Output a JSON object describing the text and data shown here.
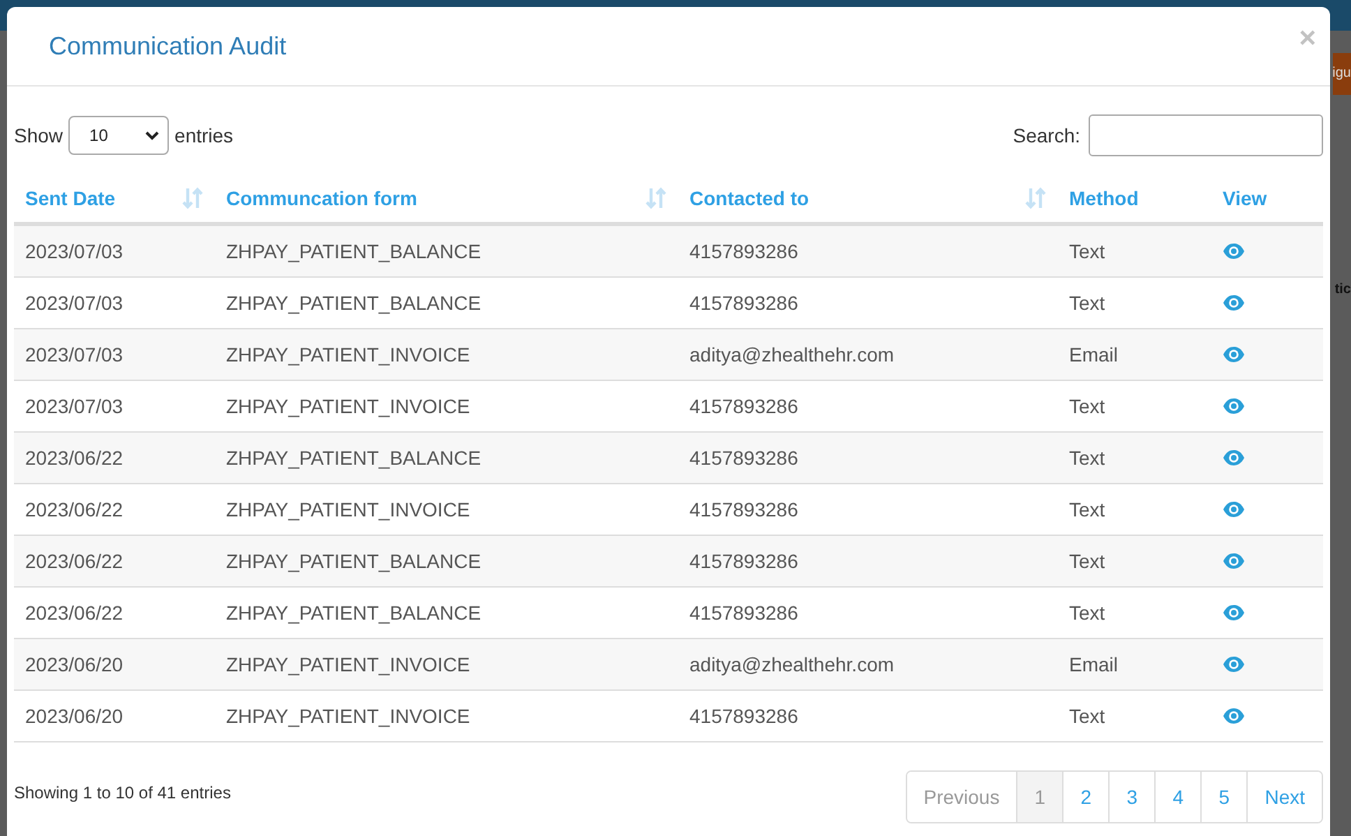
{
  "background": {
    "fragments": [
      {
        "text": "igu",
        "kind": "button"
      },
      {
        "text": "tic",
        "kind": "label"
      }
    ]
  },
  "modal": {
    "title": "Communication Audit",
    "close": "×"
  },
  "length_menu": {
    "before": "Show",
    "value": "10",
    "after": "entries"
  },
  "search": {
    "label": "Search:"
  },
  "table": {
    "columns": [
      {
        "label": "Sent Date",
        "sortable": true
      },
      {
        "label": "Communcation form",
        "sortable": true
      },
      {
        "label": "Contacted to",
        "sortable": true
      },
      {
        "label": "Method",
        "sortable": false
      },
      {
        "label": "View",
        "sortable": false
      }
    ],
    "rows": [
      [
        "2023/07/03",
        "ZHPAY_PATIENT_BALANCE",
        "4157893286",
        "Text"
      ],
      [
        "2023/07/03",
        "ZHPAY_PATIENT_BALANCE",
        "4157893286",
        "Text"
      ],
      [
        "2023/07/03",
        "ZHPAY_PATIENT_INVOICE",
        "aditya@zhealthehr.com",
        "Email"
      ],
      [
        "2023/07/03",
        "ZHPAY_PATIENT_INVOICE",
        "4157893286",
        "Text"
      ],
      [
        "2023/06/22",
        "ZHPAY_PATIENT_BALANCE",
        "4157893286",
        "Text"
      ],
      [
        "2023/06/22",
        "ZHPAY_PATIENT_INVOICE",
        "4157893286",
        "Text"
      ],
      [
        "2023/06/22",
        "ZHPAY_PATIENT_BALANCE",
        "4157893286",
        "Text"
      ],
      [
        "2023/06/22",
        "ZHPAY_PATIENT_BALANCE",
        "4157893286",
        "Text"
      ],
      [
        "2023/06/20",
        "ZHPAY_PATIENT_INVOICE",
        "aditya@zhealthehr.com",
        "Email"
      ],
      [
        "2023/06/20",
        "ZHPAY_PATIENT_INVOICE",
        "4157893286",
        "Text"
      ]
    ]
  },
  "info": "Showing 1 to 10 of 41 entries",
  "pagination": [
    {
      "label": "Previous",
      "kind": "nav",
      "disabled": true,
      "selected": false
    },
    {
      "label": "1",
      "kind": "page",
      "disabled": false,
      "selected": true
    },
    {
      "label": "2",
      "kind": "page",
      "disabled": false,
      "selected": false
    },
    {
      "label": "3",
      "kind": "page",
      "disabled": false,
      "selected": false
    },
    {
      "label": "4",
      "kind": "page",
      "disabled": false,
      "selected": false
    },
    {
      "label": "5",
      "kind": "page",
      "disabled": false,
      "selected": false
    },
    {
      "label": "Next",
      "kind": "nav",
      "disabled": false,
      "selected": false
    }
  ]
}
